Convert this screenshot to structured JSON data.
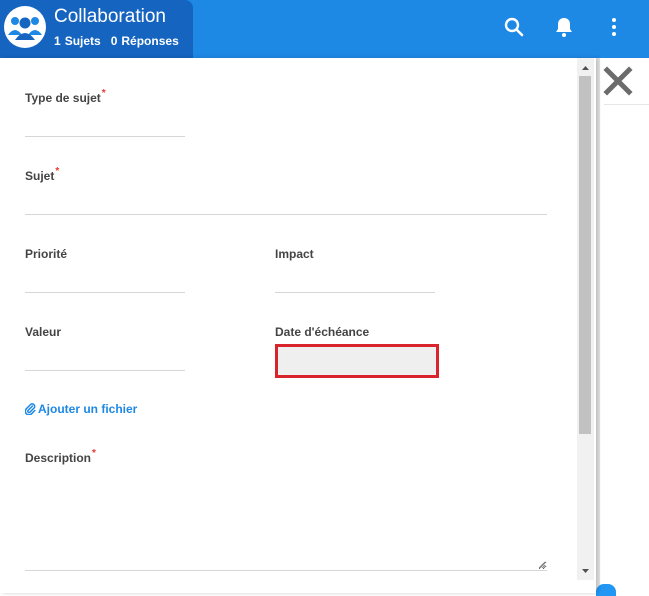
{
  "header": {
    "title": "Collaboration",
    "subjects_count": "1",
    "subjects_label": "Sujets",
    "replies_count": "0",
    "replies_label": "Réponses",
    "icons": [
      "search-icon",
      "bell-icon",
      "more-vert-icon"
    ]
  },
  "form": {
    "subject_type_label": "Type de sujet",
    "subject_label": "Sujet",
    "priority_label": "Priorité",
    "impact_label": "Impact",
    "value_label": "Valeur",
    "due_date_label": "Date d'échéance",
    "attach_label": "Ajouter un fichier",
    "description_label": "Description",
    "required_mark": "*"
  },
  "colors": {
    "header_blue": "#1e88e5",
    "header_tab_blue": "#1565c0",
    "link_blue": "#1e88e5",
    "required_red": "#e53935",
    "highlight_red": "#d9232d"
  }
}
